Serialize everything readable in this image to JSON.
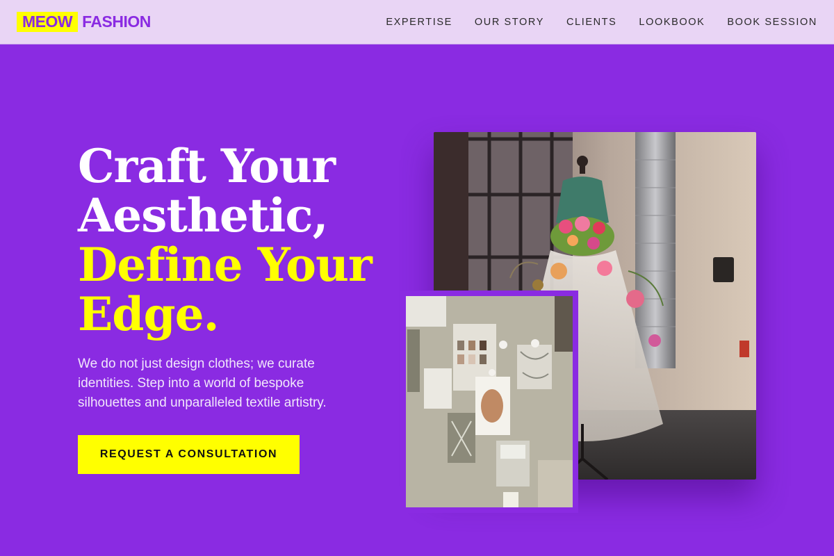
{
  "brand": {
    "part1": "MEOW",
    "part2": "FASHION"
  },
  "nav": {
    "items": [
      "EXPERTISE",
      "OUR STORY",
      "CLIENTS",
      "LOOKBOOK",
      "BOOK SESSION"
    ]
  },
  "hero": {
    "line1": "Craft Your",
    "line2": "Aesthetic,",
    "line3": "Define Your",
    "line4": "Edge.",
    "description": "We do not just design clothes; we curate identities. Step into a world of bespoke silhouettes and unparalleled textile artistry.",
    "cta": "REQUEST A CONSULTATION"
  },
  "colors": {
    "background": "#8a2be2",
    "nav_background": "#e9d5f5",
    "accent": "#ffff00",
    "text": "#ffffff"
  }
}
